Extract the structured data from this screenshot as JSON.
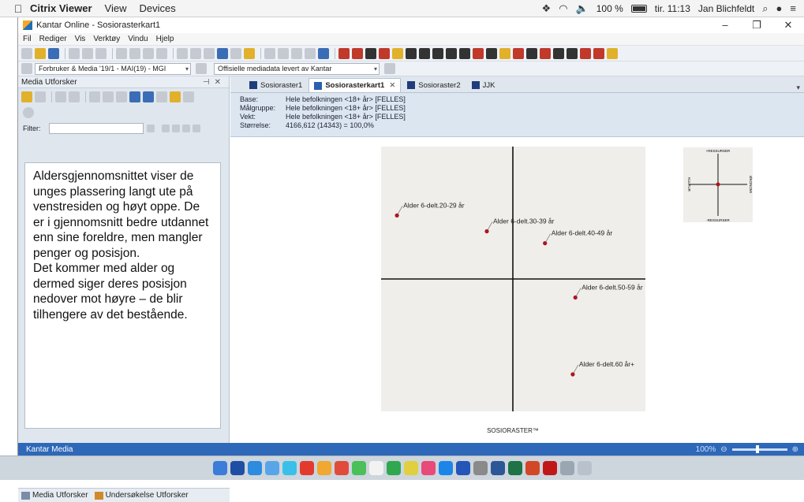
{
  "mac_menubar": {
    "app_name": "Citrix Viewer",
    "menus": [
      "View",
      "Devices"
    ],
    "battery": "100 %",
    "clock": "tir. 11:13",
    "user": "Jan Blichfeldt"
  },
  "window": {
    "title": "Kantar Online - Sosiorasterkart1",
    "menus": [
      "Fil",
      "Rediger",
      "Vis",
      "Verktøy",
      "Vindu",
      "Hjelp"
    ]
  },
  "toolbar2": {
    "study_combo": "Forbruker & Media '19/1 - MAI(19) - MGI",
    "source_combo": "Offisielle mediadata levert av Kantar"
  },
  "left_pane": {
    "title": "Media Utforsker",
    "filter_label": "Filter:",
    "filter_value": "",
    "note": "Aldersgjennomsnittet viser de unges plassering langt ute på venstresiden og høyt oppe. De er i gjennomsnitt bedre utdannet enn sine foreldre, men mangler penger og posisjon.\nDet kommer med alder og dermed siger deres posisjon nedover mot høyre – de blir tilhengere av det bestående.",
    "footer_tabs": [
      "Media Utforsker",
      "Undersøkelse Utforsker"
    ]
  },
  "tabs": [
    {
      "label": "Sosioraster1",
      "active": false
    },
    {
      "label": "Sosiorasterkart1",
      "active": true
    },
    {
      "label": "Sosioraster2",
      "active": false
    },
    {
      "label": "JJK",
      "active": false
    }
  ],
  "info": {
    "base_label": "Base:",
    "base_value": "Hele befolkningen <18+ år> [FELLES]",
    "target_label": "Målgruppe:",
    "target_value": "Hele befolkningen <18+ år> [FELLES]",
    "weight_label": "Vekt:",
    "weight_value": "Hele befolkningen <18+ år> [FELLES]",
    "size_label": "Størrelse:",
    "size_value": "4166,612  (14343) = 100,0%"
  },
  "status": {
    "left": "Kantar Media",
    "zoom": "100%"
  },
  "colors": {
    "point": "#b3121b",
    "plot_bg": "#efeeeb",
    "status_bar": "#2e68b8"
  },
  "chart_data": {
    "type": "scatter",
    "xlim": [
      -1,
      1
    ],
    "ylim": [
      -1,
      1
    ],
    "grid": false,
    "points": [
      {
        "label": "Alder 6-delt.20-29 år",
        "x": -0.88,
        "y": 0.48
      },
      {
        "label": "Alder 6-delt.30-39 år",
        "x": -0.2,
        "y": 0.36
      },
      {
        "label": "Alder 6-delt.40-49 år",
        "x": 0.24,
        "y": 0.27
      },
      {
        "label": "Alder 6-delt.50-59 år",
        "x": 0.47,
        "y": -0.14
      },
      {
        "label": "Alder 6-delt.60 år+",
        "x": 0.45,
        "y": -0.72
      }
    ],
    "caption": "SOSIORASTER™",
    "mini_legend": {
      "top": "+RESSURSER",
      "bottom": "-RESSURSER",
      "left": "KULTUR",
      "right": "ØKONOMI"
    }
  }
}
